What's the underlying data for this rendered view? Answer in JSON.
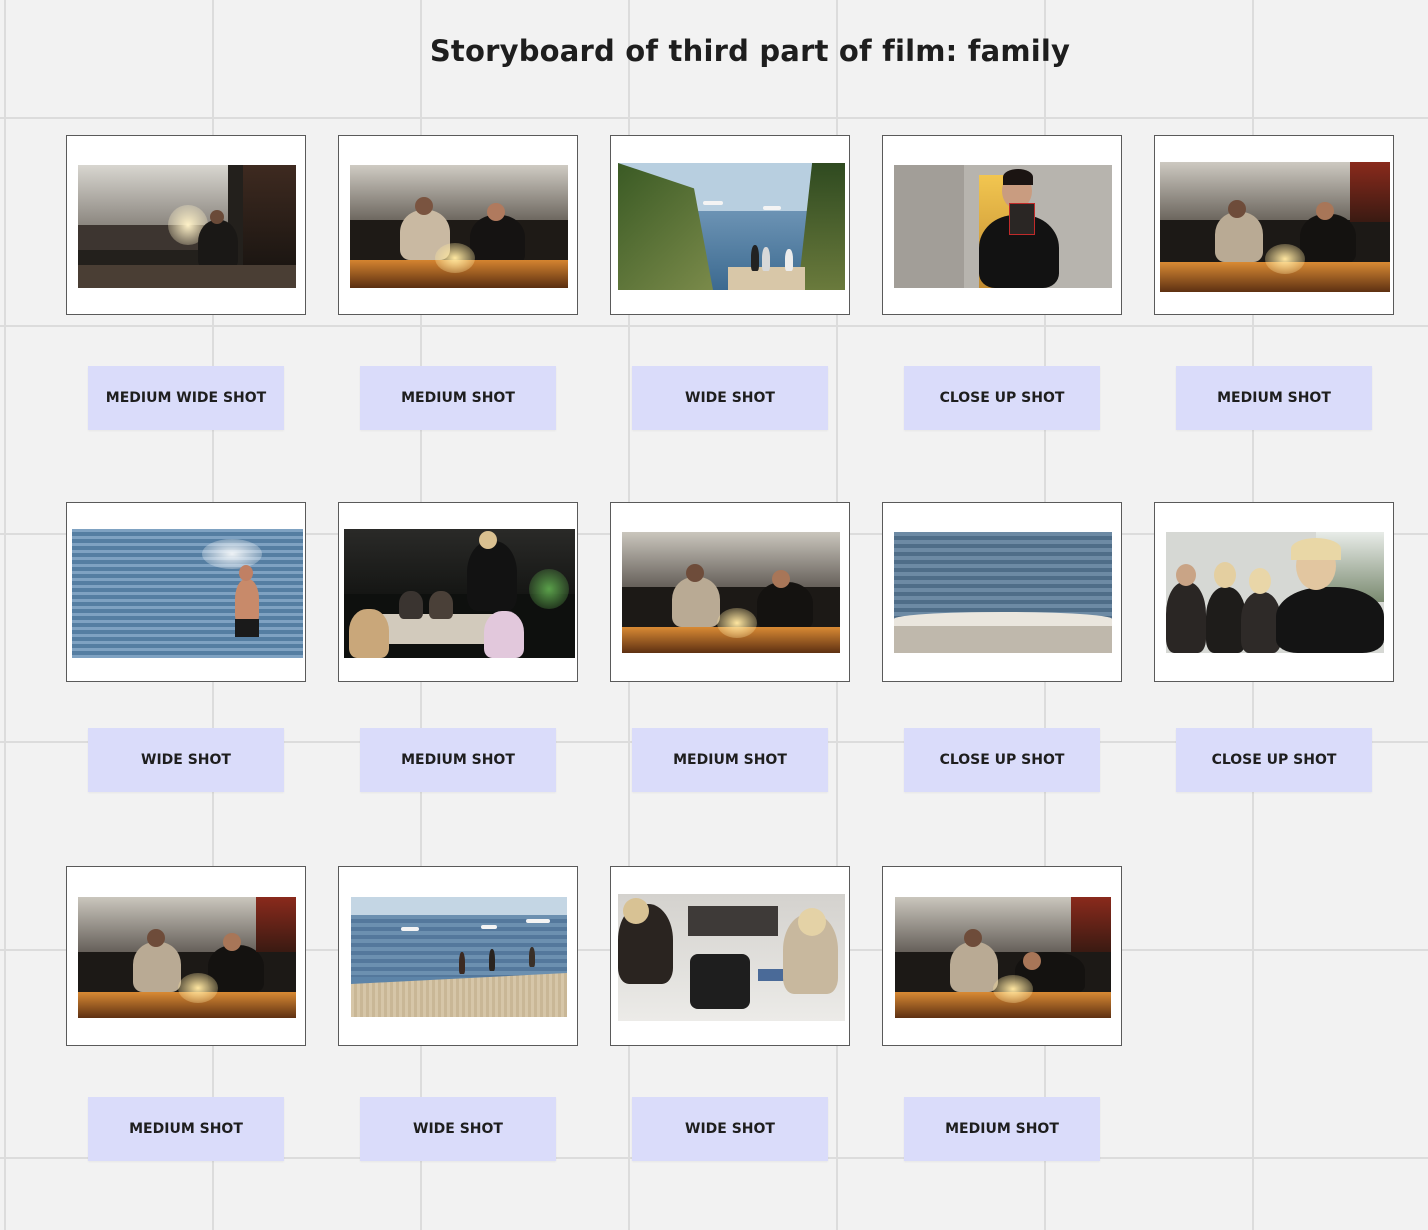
{
  "board": {
    "title": "Storyboard of third part of film: family"
  },
  "frames": [
    {
      "shot": "MEDIUM WIDE SHOT",
      "scene": "dim kitchen, figure holding candle"
    },
    {
      "shot": "MEDIUM SHOT",
      "scene": "two people at table with birthday cake"
    },
    {
      "shot": "WIDE SHOT",
      "scene": "coastal path down to beach with boats"
    },
    {
      "shot": "CLOSE UP SHOT",
      "scene": "woman holding small card"
    },
    {
      "shot": "MEDIUM SHOT",
      "scene": "two people at table with candles"
    },
    {
      "shot": "WIDE SHOT",
      "scene": "man wading in the sea"
    },
    {
      "shot": "MEDIUM SHOT",
      "scene": "friends around table at night"
    },
    {
      "shot": "MEDIUM SHOT",
      "scene": "two people at table with cake"
    },
    {
      "shot": "CLOSE UP SHOT",
      "scene": "small wave on the shore"
    },
    {
      "shot": "CLOSE UP SHOT",
      "scene": "friends smiling by window"
    },
    {
      "shot": "MEDIUM SHOT",
      "scene": "two people with cake, candles lit"
    },
    {
      "shot": "WIDE SHOT",
      "scene": "beach with swimmers and boats"
    },
    {
      "shot": "WIDE SHOT",
      "scene": "overhead view of table with items"
    },
    {
      "shot": "MEDIUM SHOT",
      "scene": "blowing out candles"
    }
  ]
}
